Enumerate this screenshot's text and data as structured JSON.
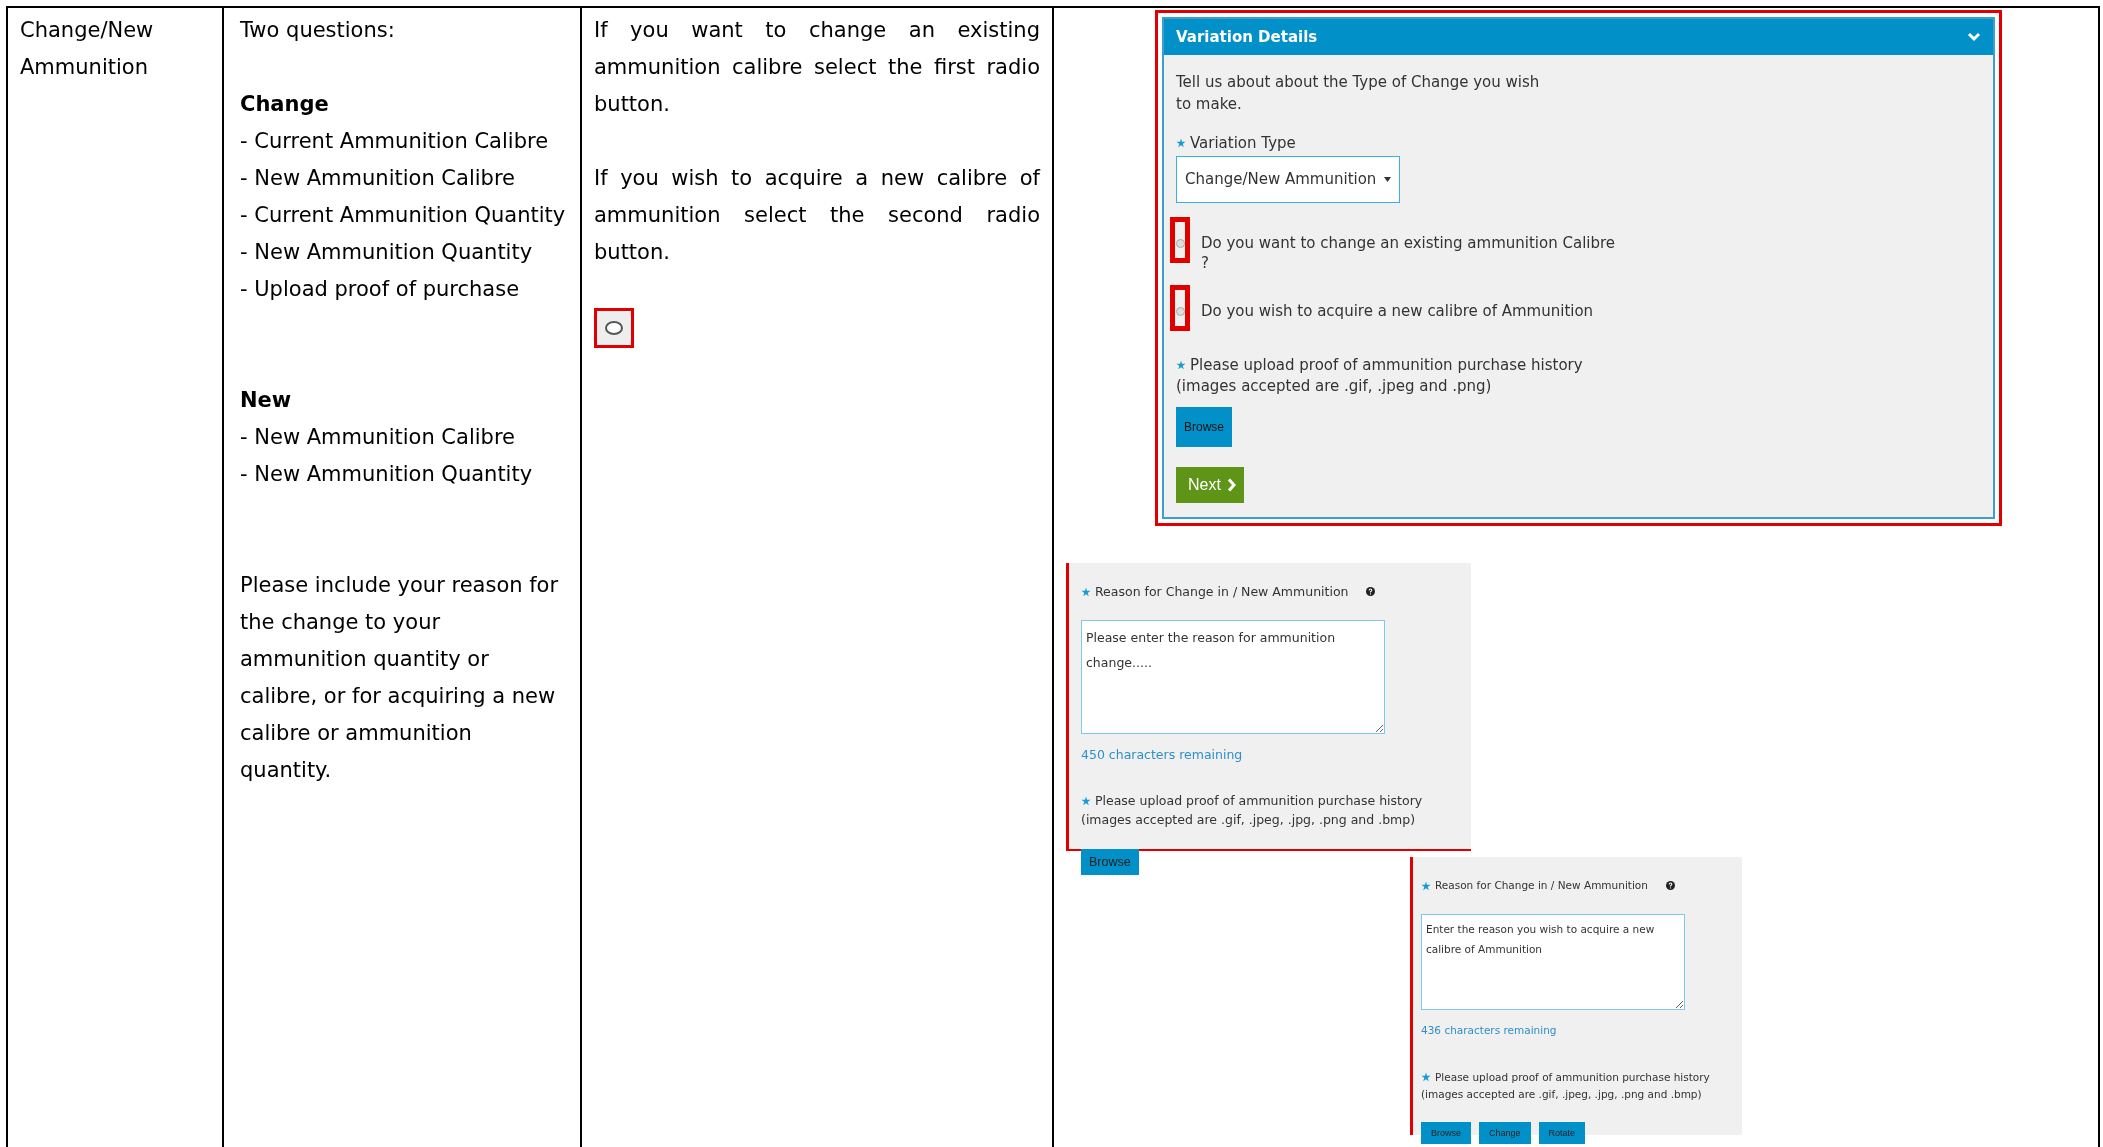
{
  "table": {
    "rows": [
      {
        "field": "Change/New Ammunition",
        "questions_intro": "Two questions:",
        "groups": [
          {
            "heading": "Change",
            "items": [
              "- Current Ammunition Calibre",
              "- New Ammunition Calibre",
              "- Current Ammunition Quantity",
              "- New Ammunition Quantity",
              "- Upload proof of purchase"
            ]
          },
          {
            "heading": "New",
            "items": [
              "- New Ammunition Calibre",
              "- New Ammunition Quantity"
            ]
          }
        ],
        "note": "Please include your reason for the change to your ammunition quantity or calibre, or for acquiring a new calibre or ammunition quantity.",
        "guidance": [
          "If you want to change an existing ammunition calibre select the first radio button.",
          "If you wish to acquire a new calibre of ammunition select the second radio button."
        ],
        "radio_example": {
          "selected": false
        },
        "variation_panel": {
          "title": "Variation Details",
          "expanded": true,
          "intro": "Tell us about about the Type of Change you wish to make.",
          "variation_label": "Variation Type",
          "variation_value": "Change/New Ammunition",
          "options": [
            {
              "label": "Do you want to change an existing ammunition Calibre ?",
              "selected": false
            },
            {
              "label": "Do you wish to acquire a new calibre of Ammunition",
              "selected": false
            }
          ],
          "upload_label": "Please upload proof of ammunition purchase history",
          "upload_note": "(images accepted are .gif, .jpeg and .png)",
          "buttons": [
            {
              "label": "Browse",
              "kind": "upload"
            },
            {
              "label": "Next",
              "kind": "next"
            }
          ]
        },
        "reason_panels": [
          {
            "label": "Reason for Change in / New Ammunition",
            "value": "Please enter the reason for ammunition change.....",
            "counter": "450 characters remaining",
            "upload_label": "Please upload proof of ammunition purchase history",
            "upload_note": "(images accepted are .gif, .jpeg, .jpg, .png and .bmp)",
            "buttons": [
              "Browse"
            ]
          },
          {
            "label": "Reason for Change in / New Ammunition",
            "value": "Enter the reason you wish to acquire a new calibre of Ammunition",
            "counter": "436 characters remaining",
            "upload_label": "Please upload proof of ammunition purchase history",
            "upload_note": "(images accepted are .gif, .jpeg, .jpg, .png and .bmp)",
            "buttons": [
              "Browse",
              "Change",
              "Rotate"
            ]
          }
        ]
      }
    ]
  }
}
